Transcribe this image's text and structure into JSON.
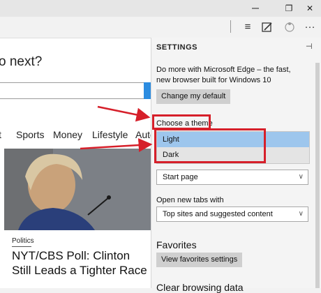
{
  "window": {
    "restore_icon": "❐",
    "close_icon": "✕"
  },
  "toolbar": {
    "hub_icon": "≡",
    "note_icon": "✎",
    "share_icon": "⌂",
    "more_icon": "···"
  },
  "page": {
    "headline": "o next?",
    "nav": [
      "t",
      "Sports",
      "Money",
      "Lifestyle",
      "Auto"
    ],
    "story_category": "Politics",
    "story_title": "NYT/CBS Poll: Clinton Still Leads a Tighter Race"
  },
  "settings": {
    "title": "SETTINGS",
    "pin_icon": "⊣",
    "promo": "Do more with Microsoft Edge – the fast, new browser built for Windows 10",
    "change_default_label": "Change my default",
    "theme_label": "Choose a theme",
    "theme_options": [
      "Light",
      "Dark"
    ],
    "theme_selected": "Light",
    "open_with_value": "Start page",
    "new_tabs_label": "Open new tabs with",
    "new_tabs_value": "Top sites and suggested content",
    "favorites_title": "Favorites",
    "favorites_button": "View favorites settings",
    "clear_title": "Clear browsing data"
  },
  "colors": {
    "accent": "#2c8ce0",
    "highlight": "#d61f2a",
    "selected": "#9dc6ed"
  }
}
